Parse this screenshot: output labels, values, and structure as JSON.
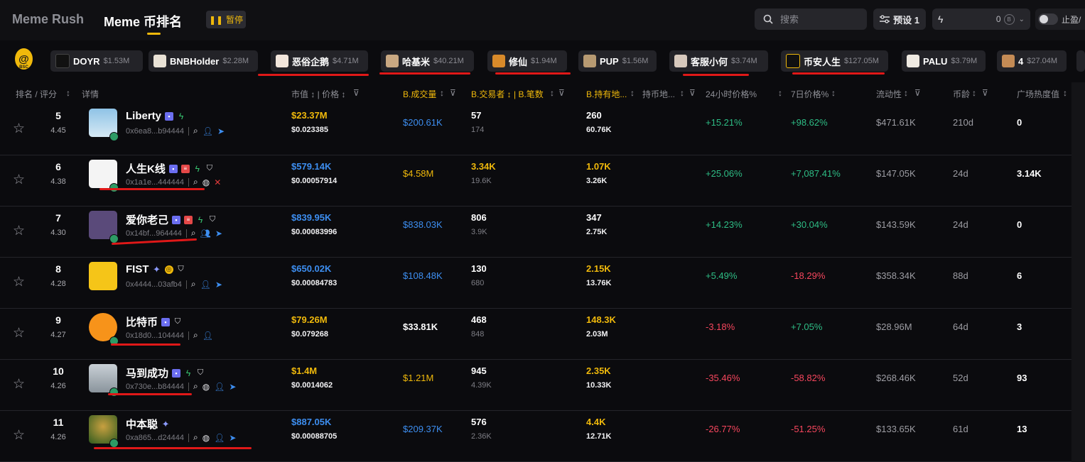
{
  "nav": {
    "tab_rush": "Meme Rush",
    "tab_rank": "Meme 币排名",
    "pause_label": "暂停"
  },
  "search": {
    "placeholder": "搜索"
  },
  "preset": {
    "label": "预设 1"
  },
  "quick": {
    "value": "0"
  },
  "tp": {
    "label": "止盈/"
  },
  "colors": {
    "accent": "#f0b90b",
    "up": "#2ebd85",
    "down": "#f6465d",
    "link": "#3d8ef0",
    "annotation": "#e01818"
  },
  "tags": [
    {
      "name": "DOYR",
      "value": "$1.53M"
    },
    {
      "name": "BNBHolder",
      "value": "$2.28M"
    },
    {
      "name": "恶俗企鹅",
      "value": "$4.71M"
    },
    {
      "name": "哈基米",
      "value": "$40.21M"
    },
    {
      "name": "修仙",
      "value": "$1.94M"
    },
    {
      "name": "PUP",
      "value": "$1.56M"
    },
    {
      "name": "客服小何",
      "value": "$3.74M"
    },
    {
      "name": "币安人生",
      "value": "$127.05M"
    },
    {
      "name": "PALU",
      "value": "$3.79M"
    },
    {
      "name": "4",
      "value": "$27.04M"
    }
  ],
  "columns": {
    "rank": "排名 / 评分",
    "detail": "详情",
    "mcap_price": "市值 ↕ | 价格 ↕",
    "volume": "B.成交量",
    "traders_txns": "B.交易者 ↕ | B.笔数",
    "holders": "B.持有地...",
    "holders2": "持币地...",
    "change_24h": "24小时价格%",
    "change_7d": "7日价格%",
    "liquidity": "流动性",
    "age": "币龄",
    "heat": "广场热度值"
  },
  "rows": [
    {
      "rank": "5",
      "score": "4.45",
      "name": "Liberty",
      "address": "0x6ea8...b94444",
      "mcap": "$23.37M",
      "price": "$0.023385",
      "volume": "$200.61K",
      "traders": "57",
      "txns": "174",
      "holders": "260",
      "holders2": "60.76K",
      "change_24h": "+15.21%",
      "change_7d": "+98.62%",
      "liquidity": "$471.61K",
      "age": "210d",
      "heat": "0"
    },
    {
      "rank": "6",
      "score": "4.38",
      "name": "人生K线",
      "address": "0x1a1e...444444",
      "mcap": "$579.14K",
      "price": "$0.00057914",
      "volume": "$4.58M",
      "traders": "3.34K",
      "txns": "19.6K",
      "holders": "1.07K",
      "holders2": "3.26K",
      "change_24h": "+25.06%",
      "change_7d": "+7,087.41%",
      "liquidity": "$147.05K",
      "age": "24d",
      "heat": "3.14K"
    },
    {
      "rank": "7",
      "score": "4.30",
      "name": "爱你老己",
      "address": "0x14bf...964444",
      "mcap": "$839.95K",
      "price": "$0.00083996",
      "volume": "$838.03K",
      "traders": "806",
      "txns": "3.9K",
      "holders": "347",
      "holders2": "2.75K",
      "change_24h": "+14.23%",
      "change_7d": "+30.04%",
      "liquidity": "$143.59K",
      "age": "24d",
      "heat": "0"
    },
    {
      "rank": "8",
      "score": "4.28",
      "name": "FIST",
      "address": "0x4444...03afb4",
      "mcap": "$650.02K",
      "price": "$0.00084783",
      "volume": "$108.48K",
      "traders": "130",
      "txns": "680",
      "holders": "2.15K",
      "holders2": "13.76K",
      "change_24h": "+5.49%",
      "change_7d": "-18.29%",
      "liquidity": "$358.34K",
      "age": "88d",
      "heat": "6"
    },
    {
      "rank": "9",
      "score": "4.27",
      "name": "比特币",
      "address": "0x18d0...104444",
      "mcap": "$79.26M",
      "price": "$0.079268",
      "volume": "$33.81K",
      "traders": "468",
      "txns": "848",
      "holders": "148.3K",
      "holders2": "2.03M",
      "change_24h": "-3.18%",
      "change_7d": "+7.05%",
      "liquidity": "$28.96M",
      "age": "64d",
      "heat": "3"
    },
    {
      "rank": "10",
      "score": "4.26",
      "name": "马到成功",
      "address": "0x730e...b84444",
      "mcap": "$1.4M",
      "price": "$0.0014062",
      "volume": "$1.21M",
      "traders": "945",
      "txns": "4.39K",
      "holders": "2.35K",
      "holders2": "10.33K",
      "change_24h": "-35.46%",
      "change_7d": "-58.82%",
      "liquidity": "$268.46K",
      "age": "52d",
      "heat": "93"
    },
    {
      "rank": "11",
      "score": "4.26",
      "name": "中本聪",
      "address": "0xa865...d24444",
      "mcap": "$887.05K",
      "price": "$0.00088705",
      "volume": "$209.37K",
      "traders": "576",
      "txns": "2.36K",
      "holders": "4.4K",
      "holders2": "12.71K",
      "change_24h": "-26.77%",
      "change_7d": "-51.25%",
      "liquidity": "$133.65K",
      "age": "61d",
      "heat": "13"
    }
  ]
}
